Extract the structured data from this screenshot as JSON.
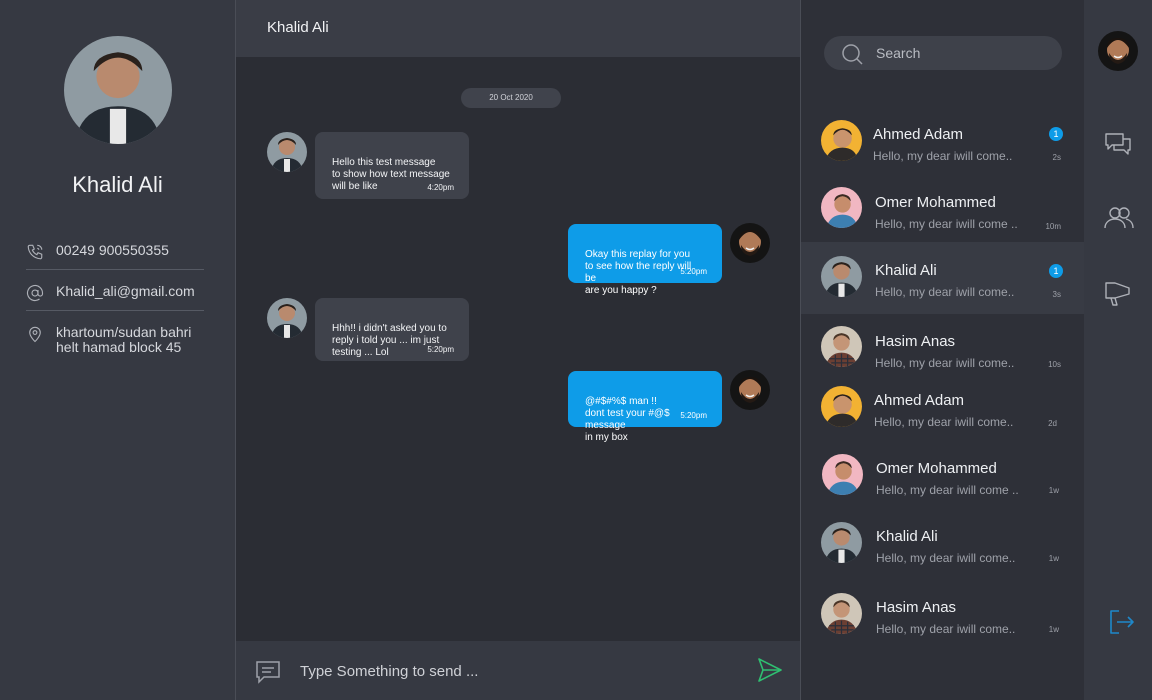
{
  "profile": {
    "name": "Khalid Ali",
    "phone": "00249 900550355",
    "email": "Khalid_ali@gmail.com",
    "address": "khartoum/sudan bahri\nhelt hamad block 45"
  },
  "chat": {
    "title": "Khalid Ali",
    "date": "20 Oct 2020",
    "messages": [
      {
        "text": "Hello this test message\nto show how text message\nwill be like",
        "time": "4:20pm"
      },
      {
        "text": "Okay this replay for you\nto see how the reply will be\nare you happy ?",
        "time": "5:20pm"
      },
      {
        "text": "Hhh!! i didn't asked you to\nreply i told you ... im just\ntesting ... Lol",
        "time": "5:20pm"
      },
      {
        "text": "@#$#%$ man !!\ndont test your #@$ message\nin my box",
        "time": "5:20pm"
      }
    ],
    "composer_placeholder": "Type Something to send ..."
  },
  "search": {
    "placeholder": "Search"
  },
  "contacts": [
    {
      "name": "Ahmed Adam",
      "preview": "Hello, my dear iwill come..",
      "ago": "2s",
      "unread": "1"
    },
    {
      "name": "Omer Mohammed",
      "preview": "Hello, my dear iwill come ..",
      "ago": "10m"
    },
    {
      "name": "Khalid Ali",
      "preview": "Hello, my dear iwill come..",
      "ago": "3s",
      "unread": "1"
    },
    {
      "name": "Hasim Anas",
      "preview": "Hello, my dear iwill come..",
      "ago": "10s"
    },
    {
      "name": "Ahmed Adam",
      "preview": "Hello, my dear iwill come..",
      "ago": "2d"
    },
    {
      "name": "Omer Mohammed",
      "preview": "Hello, my dear iwill come ..",
      "ago": "1w"
    },
    {
      "name": "Khalid Ali",
      "preview": "Hello, my dear iwill come..",
      "ago": "1w"
    },
    {
      "name": "Hasim Anas",
      "preview": "Hello, my dear iwill come..",
      "ago": "1w"
    }
  ],
  "icons": {
    "phone": "phone-icon",
    "email": "at-sign-icon",
    "location": "location-pin-icon",
    "search": "search-icon",
    "messages": "chat-bubbles-icon",
    "contacts": "users-icon",
    "announcements": "megaphone-icon",
    "logout": "logout-icon",
    "send": "send-icon"
  },
  "colors": {
    "accent": "#0e9ce8",
    "send_icon": "#2fbf71",
    "logout_icon": "#1e88c9"
  }
}
